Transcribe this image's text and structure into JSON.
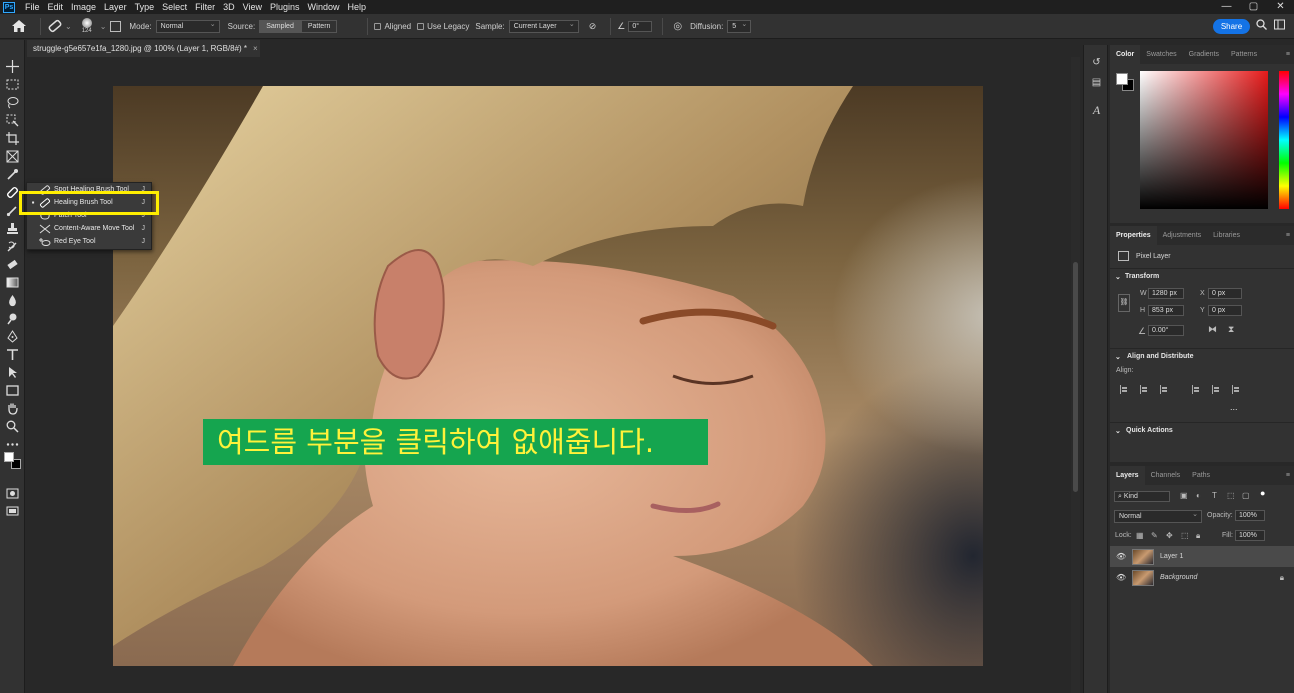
{
  "menubar": {
    "items": [
      "File",
      "Edit",
      "Image",
      "Layer",
      "Type",
      "Select",
      "Filter",
      "3D",
      "View",
      "Plugins",
      "Window",
      "Help"
    ],
    "logo": "Ps",
    "window_controls": [
      "—",
      "▢",
      "✕"
    ]
  },
  "options": {
    "brush_size": "124",
    "mode_label": "Mode:",
    "mode_value": "Normal",
    "source_label": "Source:",
    "source_sampled": "Sampled",
    "source_pattern": "Pattern",
    "aligned_label": "Aligned",
    "use_legacy_label": "Use Legacy",
    "sample_label": "Sample:",
    "sample_value": "Current Layer",
    "angle_value": "0°",
    "diffusion_label": "Diffusion:",
    "diffusion_value": "5",
    "share_label": "Share"
  },
  "document": {
    "tab_title": "struggle-g5e657e1fa_1280.jpg @ 100% (Layer 1, RGB/8#) *",
    "close_glyph": "×"
  },
  "caption": {
    "text": "여드름 부분을 클릭하여 없애줍니다."
  },
  "flyout": {
    "items": [
      {
        "label": "Spot Healing Brush Tool",
        "key": "J",
        "active": false
      },
      {
        "label": "Healing Brush Tool",
        "key": "J",
        "active": true
      },
      {
        "label": "Patch Tool",
        "key": "J",
        "active": false
      },
      {
        "label": "Content-Aware Move Tool",
        "key": "J",
        "active": false
      },
      {
        "label": "Red Eye Tool",
        "key": "J",
        "active": false
      }
    ],
    "active_marker": "▪"
  },
  "color_panel": {
    "tabs": [
      "Color",
      "Swatches",
      "Gradients",
      "Patterns"
    ]
  },
  "properties_panel": {
    "tabs": [
      "Properties",
      "Adjustments",
      "Libraries"
    ],
    "layer_type": "Pixel Layer",
    "transform_title": "Transform",
    "w_label": "W",
    "w_value": "1280 px",
    "h_label": "H",
    "h_value": "853 px",
    "x_label": "X",
    "x_value": "0 px",
    "y_label": "Y",
    "y_value": "0 px",
    "angle_value": "0.00°",
    "align_title": "Align and Distribute",
    "align_label": "Align:",
    "more": "...",
    "quick_actions_title": "Quick Actions"
  },
  "layers_panel": {
    "tabs": [
      "Layers",
      "Channels",
      "Paths"
    ],
    "kind_label": "Kind",
    "blend_mode": "Normal",
    "opacity_label": "Opacity:",
    "opacity_value": "100%",
    "lock_label": "Lock:",
    "fill_label": "Fill:",
    "fill_value": "100%",
    "layers": [
      {
        "name": "Layer 1",
        "selected": true,
        "locked": false
      },
      {
        "name": "Background",
        "selected": false,
        "locked": true
      }
    ]
  },
  "colors": {
    "accent": "#1473e6",
    "highlight": "#ffee00",
    "caption_bg": "#15a54f",
    "caption_text": "#fff23a"
  }
}
